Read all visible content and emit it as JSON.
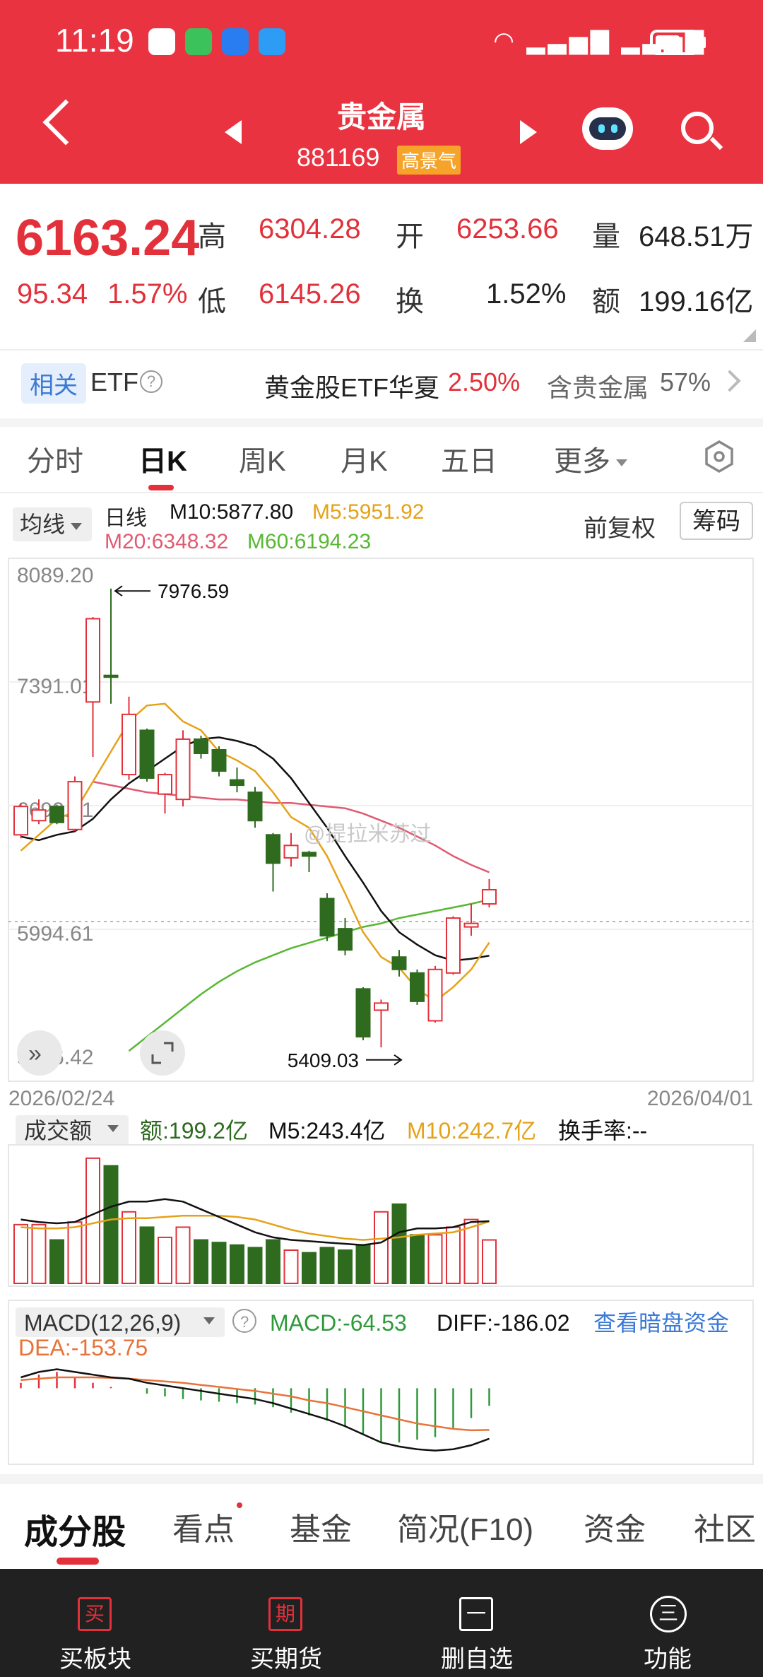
{
  "status_bar": {
    "time": "11:19"
  },
  "header": {
    "title": "贵金属",
    "code": "881169",
    "badge": "高景气"
  },
  "quote": {
    "price": "6163.24",
    "change": "95.34",
    "change_pct": "1.57%",
    "high_label": "高",
    "high": "6304.28",
    "low_label": "低",
    "low": "6145.26",
    "open_label": "开",
    "open": "6253.66",
    "turnover_label": "换",
    "turnover": "1.52%",
    "volume_label": "量",
    "volume": "648.51万",
    "amount_label": "额",
    "amount": "199.16亿"
  },
  "etf_row": {
    "tag": "相关",
    "label": "ETF",
    "fund_name": "黄金股ETF华夏",
    "fund_change": "2.50%",
    "contains_label": "含贵金属",
    "contains_pct": "57%"
  },
  "tabs": [
    "分时",
    "日K",
    "周K",
    "月K",
    "五日",
    "更多"
  ],
  "active_tab": "日K",
  "chart_header": {
    "ma_selector": "均线",
    "period": "日线",
    "m10": "M10:5877.80",
    "m5": "M5:5951.92",
    "m20": "M20:6348.32",
    "m60": "M60:6194.23",
    "adjust": "前复权",
    "chips_button": "筹码"
  },
  "colors": {
    "up": "#e2313b",
    "down": "#2e6b1f",
    "m5": "#e5a219",
    "m10": "#111111",
    "m20": "#e05a72",
    "m60": "#58b734",
    "header_bg": "#ea3340",
    "link": "#3b79d6"
  },
  "watermark": "@提拉米苏过",
  "chart_data": [
    {
      "type": "candlestick",
      "y_ticks": [
        "8089.20",
        "7391.01",
        "6692.81",
        "5994.61",
        "5296.42"
      ],
      "y_tick_values": [
        8089.2,
        7391.01,
        6692.81,
        5994.61,
        5296.42
      ],
      "ylim": [
        5200,
        8150
      ],
      "x_start_label": "2026/02/24",
      "x_end_label": "2026/04/01",
      "max_label": "7976.59",
      "min_label": "5409.03",
      "max_value": 7976.59,
      "min_value": 5409.03,
      "candles": [
        {
          "o": 6560,
          "c": 6720,
          "h": 6740,
          "l": 6540
        },
        {
          "o": 6640,
          "c": 6700,
          "h": 6760,
          "l": 6620
        },
        {
          "o": 6720,
          "c": 6630,
          "h": 6730,
          "l": 6620
        },
        {
          "o": 6590,
          "c": 6860,
          "h": 6890,
          "l": 6580
        },
        {
          "o": 7310,
          "c": 7780,
          "h": 7790,
          "l": 7000
        },
        {
          "o": 7460,
          "c": 7450,
          "h": 7950,
          "l": 7300
        },
        {
          "o": 6900,
          "c": 7240,
          "h": 7340,
          "l": 6870
        },
        {
          "o": 7150,
          "c": 6880,
          "h": 7160,
          "l": 6860
        },
        {
          "o": 6790,
          "c": 6900,
          "h": 6910,
          "l": 6680
        },
        {
          "o": 6760,
          "c": 7100,
          "h": 7150,
          "l": 6720
        },
        {
          "o": 7100,
          "c": 7020,
          "h": 7120,
          "l": 6990
        },
        {
          "o": 7040,
          "c": 6920,
          "h": 7060,
          "l": 6890
        },
        {
          "o": 6870,
          "c": 6840,
          "h": 6940,
          "l": 6800
        },
        {
          "o": 6800,
          "c": 6640,
          "h": 6830,
          "l": 6600
        },
        {
          "o": 6560,
          "c": 6400,
          "h": 6570,
          "l": 6240
        },
        {
          "o": 6430,
          "c": 6500,
          "h": 6570,
          "l": 6380
        },
        {
          "o": 6460,
          "c": 6440,
          "h": 6470,
          "l": 6350
        },
        {
          "o": 6200,
          "c": 5990,
          "h": 6230,
          "l": 5960
        },
        {
          "o": 6030,
          "c": 5910,
          "h": 6090,
          "l": 5880
        },
        {
          "o": 5690,
          "c": 5420,
          "h": 5700,
          "l": 5400
        },
        {
          "o": 5570,
          "c": 5610,
          "h": 5630,
          "l": 5360
        },
        {
          "o": 5870,
          "c": 5800,
          "h": 5910,
          "l": 5760
        },
        {
          "o": 5780,
          "c": 5620,
          "h": 5800,
          "l": 5600
        },
        {
          "o": 5510,
          "c": 5800,
          "h": 5820,
          "l": 5500
        },
        {
          "o": 5780,
          "c": 6090,
          "h": 6100,
          "l": 5770
        },
        {
          "o": 6040,
          "c": 6060,
          "h": 6170,
          "l": 5990
        },
        {
          "o": 6170,
          "c": 6250,
          "h": 6310,
          "l": 6150
        }
      ],
      "m5": [
        6470,
        6560,
        6650,
        6690,
        6860,
        7030,
        7200,
        7290,
        7300,
        7200,
        7150,
        7030,
        6980,
        6920,
        6800,
        6660,
        6600,
        6440,
        6230,
        6010,
        5870,
        5810,
        5690,
        5620,
        5700,
        5800,
        5951.92
      ],
      "m10": [
        6550,
        6530,
        6560,
        6580,
        6650,
        6760,
        6850,
        6920,
        6990,
        7060,
        7100,
        7110,
        7090,
        7060,
        6990,
        6880,
        6740,
        6600,
        6440,
        6290,
        6130,
        6010,
        5940,
        5880,
        5850,
        5860,
        5877.8
      ],
      "m20": [
        null,
        null,
        null,
        null,
        6860,
        6840,
        6820,
        6800,
        6790,
        6780,
        6770,
        6760,
        6760,
        6750,
        6740,
        6740,
        6730,
        6720,
        6710,
        6680,
        6640,
        6600,
        6550,
        6500,
        6440,
        6390,
        6348.32
      ],
      "m60": [
        null,
        null,
        null,
        null,
        null,
        null,
        5340,
        5420,
        5500,
        5580,
        5660,
        5730,
        5790,
        5840,
        5880,
        5920,
        5950,
        5980,
        6010,
        6040,
        6060,
        6090,
        6110,
        6130,
        6150,
        6170,
        6194.23
      ]
    },
    {
      "type": "bar",
      "title": "成交额",
      "series_labels": [
        "额:199.2亿",
        "M5:243.4亿",
        "M10:242.7亿",
        "换手率:--"
      ],
      "values": [
        230,
        230,
        170,
        240,
        490,
        460,
        280,
        220,
        180,
        220,
        170,
        160,
        150,
        140,
        170,
        130,
        120,
        140,
        130,
        150,
        280,
        310,
        190,
        190,
        220,
        250,
        170
      ],
      "m5": [
        250,
        240,
        235,
        240,
        270,
        300,
        320,
        320,
        330,
        320,
        290,
        260,
        230,
        200,
        180,
        170,
        165,
        160,
        155,
        150,
        160,
        200,
        215,
        215,
        220,
        240,
        243.4
      ],
      "m10": [
        220,
        215,
        215,
        220,
        235,
        250,
        255,
        255,
        260,
        265,
        265,
        265,
        260,
        250,
        230,
        210,
        195,
        185,
        175,
        170,
        175,
        180,
        190,
        195,
        200,
        220,
        242.7
      ],
      "ylim": [
        0,
        520
      ]
    },
    {
      "type": "line",
      "title": "MACD(12,26,9)",
      "series_labels": [
        "MACD:-64.53",
        "DIFF:-186.02",
        "DEA:-153.75"
      ],
      "diff": [
        40,
        60,
        70,
        60,
        50,
        40,
        35,
        20,
        10,
        0,
        -10,
        -20,
        -30,
        -40,
        -55,
        -75,
        -95,
        -115,
        -140,
        -170,
        -200,
        -215,
        -225,
        -230,
        -225,
        -210,
        -186.02
      ],
      "dea": [
        30,
        35,
        40,
        40,
        40,
        38,
        35,
        30,
        25,
        20,
        12,
        5,
        -3,
        -10,
        -20,
        -30,
        -45,
        -55,
        -70,
        -85,
        -100,
        -115,
        -130,
        -140,
        -150,
        -155,
        -153.75
      ],
      "macd": [
        20,
        50,
        60,
        40,
        20,
        5,
        0,
        -20,
        -30,
        -40,
        -45,
        -50,
        -55,
        -60,
        -70,
        -90,
        -100,
        -120,
        -140,
        -170,
        -200,
        -200,
        -190,
        -180,
        -150,
        -110,
        -64.53
      ],
      "ylim": [
        -270,
        100
      ],
      "link": "查看暗盘资金"
    }
  ],
  "bottom_tabs": [
    "成分股",
    "看点",
    "基金",
    "简况(F10)",
    "资金",
    "社区"
  ],
  "footer": [
    {
      "icon": "买",
      "label": "买板块"
    },
    {
      "icon": "期",
      "label": "买期货"
    },
    {
      "icon": "一",
      "label": "删自选"
    },
    {
      "icon": "三",
      "label": "功能"
    }
  ]
}
